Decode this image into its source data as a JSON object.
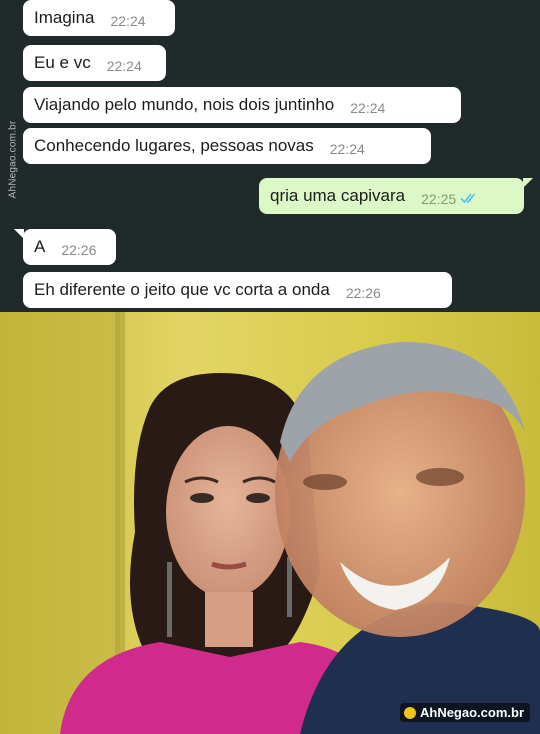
{
  "watermark": {
    "side_text": "AhNegao.com.br",
    "logo_text": "AhNegao.com.br"
  },
  "messages": [
    {
      "dir": "in",
      "text": "Imagina",
      "time": "22:24"
    },
    {
      "dir": "in",
      "text": "Eu e vc",
      "time": "22:24"
    },
    {
      "dir": "in",
      "text": "Viajando pelo mundo, nois dois juntinho",
      "time": "22:24"
    },
    {
      "dir": "in",
      "text": "Conhecendo lugares, pessoas novas",
      "time": "22:24"
    },
    {
      "dir": "out",
      "text": "qria uma capivara",
      "time": "22:25",
      "status": "read-double-check-icon"
    },
    {
      "dir": "in",
      "text": "A",
      "time": "22:26"
    },
    {
      "dir": "in",
      "text": "Eh diferente o jeito que vc corta a onda",
      "time": "22:26"
    }
  ],
  "colors": {
    "chat_background": "#212a2b",
    "incoming_bubble": "#ffffff",
    "outgoing_bubble": "#dcf8c6",
    "read_ticks": "#4fc3f7",
    "shirt_magenta": "#d0208c"
  }
}
